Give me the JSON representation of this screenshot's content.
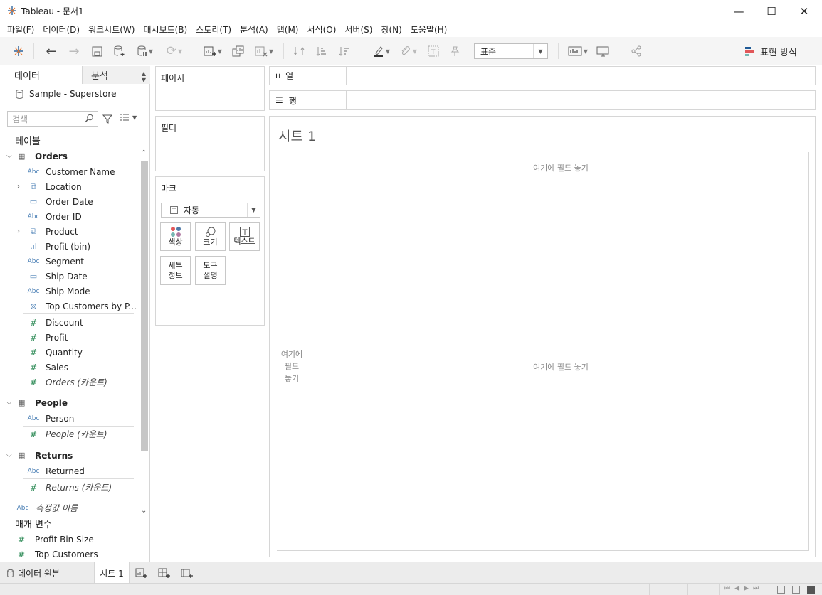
{
  "window": {
    "title": "Tableau - 문서1",
    "minimize": "—",
    "maximize": "☐",
    "close": "✕"
  },
  "menu": [
    "파일(F)",
    "데이터(D)",
    "워크시트(W)",
    "대시보드(B)",
    "스토리(T)",
    "분석(A)",
    "맵(M)",
    "서식(O)",
    "서버(S)",
    "창(N)",
    "도움말(H)"
  ],
  "toolbar": {
    "format_select": "표준",
    "show_me": "표현 방식",
    "icons": [
      "tableau-logo-icon",
      "undo-icon",
      "redo-icon",
      "save-icon",
      "new-datasource-icon",
      "pause-updates-icon",
      "refresh-icon",
      "new-worksheet-icon",
      "duplicate-sheet-icon",
      "clear-sheet-icon",
      "swap-icon",
      "sort-asc-icon",
      "sort-desc-icon",
      "highlight-icon",
      "group-icon",
      "show-labels-icon",
      "pin-icon",
      "fit-icon",
      "presentation-icon",
      "share-icon"
    ]
  },
  "left_pane": {
    "tab_data": "데이터",
    "tab_analysis": "분석",
    "datasource": "Sample - Superstore",
    "search_placeholder": "검색",
    "tables_header": "테이블",
    "tables": [
      {
        "name": "Orders",
        "fields": [
          {
            "type": "Abc",
            "name": "Customer Name"
          },
          {
            "type": "hier",
            "name": "Location",
            "expand": true
          },
          {
            "type": "date",
            "name": "Order Date"
          },
          {
            "type": "Abc",
            "name": "Order ID"
          },
          {
            "type": "hier",
            "name": "Product",
            "expand": true
          },
          {
            "type": "bin",
            "name": "Profit (bin)"
          },
          {
            "type": "Abc",
            "name": "Segment"
          },
          {
            "type": "date",
            "name": "Ship Date"
          },
          {
            "type": "Abc",
            "name": "Ship Mode"
          },
          {
            "type": "set",
            "name": "Top Customers by P..."
          }
        ],
        "measures": [
          {
            "name": "Discount"
          },
          {
            "name": "Profit"
          },
          {
            "name": "Quantity"
          },
          {
            "name": "Sales"
          },
          {
            "name": "Orders (카운트)",
            "italic": true
          }
        ]
      },
      {
        "name": "People",
        "fields": [
          {
            "type": "Abc",
            "name": "Person"
          }
        ],
        "measures": [
          {
            "name": "People (카운트)",
            "italic": true
          }
        ]
      },
      {
        "name": "Returns",
        "fields": [
          {
            "type": "Abc",
            "name": "Returned"
          }
        ],
        "measures": [
          {
            "name": "Returns (카운트)",
            "italic": true
          }
        ]
      }
    ],
    "measure_names": "측정값 이름",
    "params_header": "매개 변수",
    "params": [
      "Profit Bin Size",
      "Top Customers"
    ]
  },
  "cards": {
    "pages": "페이지",
    "filters": "필터",
    "marks": "마크",
    "mark_type": "자동",
    "mark_buttons": [
      {
        "label": "색상",
        "icon": "color-icon"
      },
      {
        "label": "크기",
        "icon": "size-icon"
      },
      {
        "label": "텍스트",
        "icon": "text-icon"
      },
      {
        "label": "세부\n정보",
        "icon": "detail-icon"
      },
      {
        "label": "도구\n설명",
        "icon": "tooltip-icon"
      }
    ]
  },
  "shelves": {
    "columns": "열",
    "rows": "행"
  },
  "view": {
    "sheet_title": "시트 1",
    "drop_top": "여기에 필드 놓기",
    "drop_main": "여기에 필드 놓기",
    "drop_left": "여기에\n필드\n놓기"
  },
  "tabs": {
    "datasource": "데이터 원본",
    "sheet": "시트 1"
  },
  "colors": {
    "accent": "#4a7fb5",
    "measure": "#2e8b57",
    "pane_bg": "#f5f5f5"
  }
}
